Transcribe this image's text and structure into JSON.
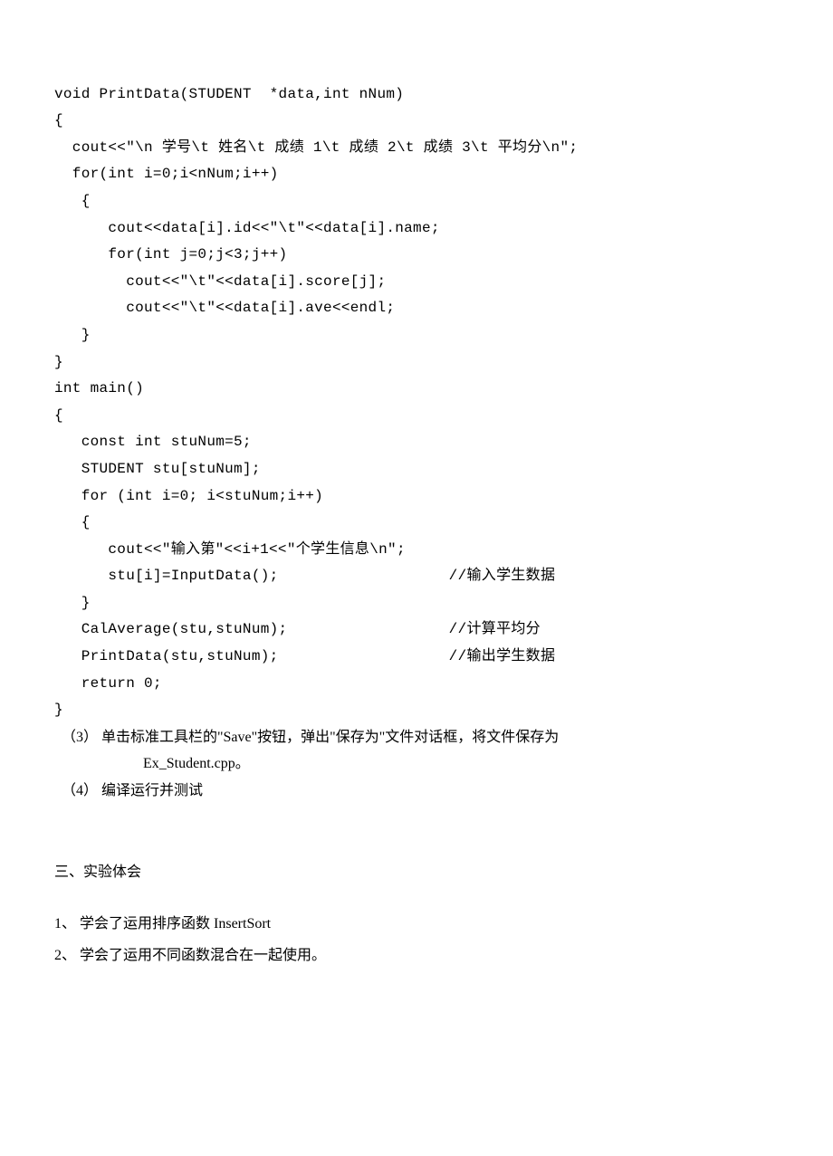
{
  "code": {
    "l1": "void PrintData(STUDENT  *data,int nNum)",
    "l2": "{",
    "l3": "  cout<<\"\\n 学号\\t 姓名\\t 成绩 1\\t 成绩 2\\t 成绩 3\\t 平均分\\n\";",
    "l4": "  for(int i=0;i<nNum;i++)",
    "l5": "   {",
    "l6": "      cout<<data[i].id<<\"\\t\"<<data[i].name;",
    "l7": "      for(int j=0;j<3;j++)",
    "l8": "        cout<<\"\\t\"<<data[i].score[j];",
    "l9": "        cout<<\"\\t\"<<data[i].ave<<endl;",
    "l10": "   }",
    "l11": "}",
    "l12": "int main()",
    "l13": "{",
    "l14": "   const int stuNum=5;",
    "l15": "   STUDENT stu[stuNum];",
    "l16": "   for (int i=0; i<stuNum;i++)",
    "l17": "   {",
    "l18": "      cout<<\"输入第\"<<i+1<<\"个学生信息\\n\";",
    "l19": "      stu[i]=InputData();                   //输入学生数据",
    "l20": "   }",
    "l21": "   CalAverage(stu,stuNum);                  //计算平均分",
    "l22": "   PrintData(stu,stuNum);                   //输出学生数据",
    "l23": "   return 0;",
    "l24": "}"
  },
  "instructions": {
    "i3a": "（3）  单击标准工具栏的\"Save\"按钮，弹出\"保存为\"文件对话框，将文件保存为",
    "i3b": "Ex_Student.cpp。",
    "i4": "（4）  编译运行并测试"
  },
  "section": {
    "title": "三、实验体会",
    "item1_prefix": "1、 学会了运用排序函数 ",
    "item1_func": "InsertSort",
    "item2": "2、 学会了运用不同函数混合在一起使用。"
  }
}
